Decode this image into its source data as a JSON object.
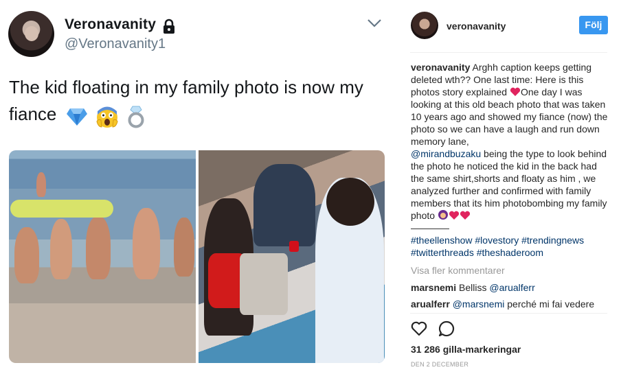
{
  "tweet": {
    "display_name": "Veronavanity",
    "handle": "@Veronavanity1",
    "text": "The kid floating in my family photo is now my fiance",
    "emojis": [
      "gem-icon",
      "screaming-face-icon",
      "ring-icon"
    ]
  },
  "instagram": {
    "username": "veronavanity",
    "follow_label": "Följ",
    "caption": {
      "author": "veronavanity",
      "part1": "Arghh caption keeps getting deleted wth?? One last time: Here is this photos story explained",
      "part2": "One day I was looking at this old beach photo that was taken 10 years ago and showed my fiance (now) the photo so we can have a laugh and run down memory lane,",
      "mention": "@mirandbuzaku",
      "part3": "being the type to look behind the photo he noticed the kid in the back had the same shirt,shorts and floaty as him , we analyzed further and confirmed with family members that its him photobombing my family photo",
      "dashes": "————",
      "hashtags": "#theellenshow #lovestory #trendingnews #twitterthreads #theshaderoom"
    },
    "view_more": "Visa fler kommentarer",
    "comments": [
      {
        "user": "marsnemi",
        "text": "Belliss",
        "mention": "@arualferr"
      },
      {
        "user": "arualferr",
        "mention": "@marsnemi",
        "text": "perché mi fai vedere"
      }
    ],
    "likes": "31 286 gilla-markeringar",
    "date": "DEN 2 DECEMBER"
  }
}
